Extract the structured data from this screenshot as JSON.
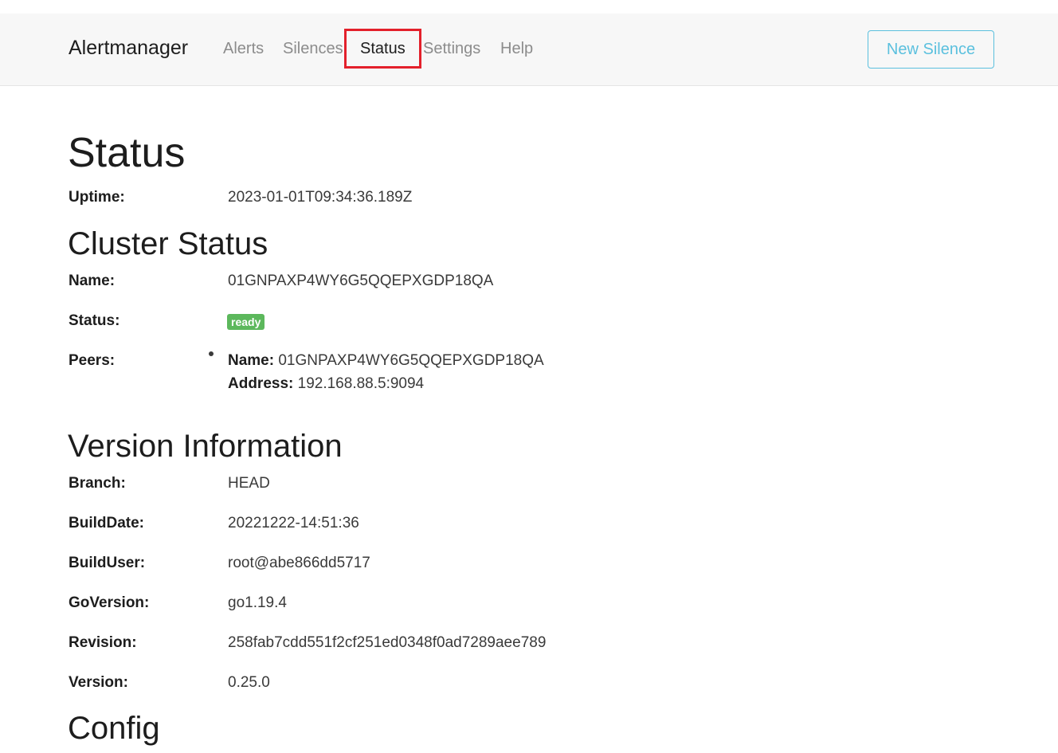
{
  "navbar": {
    "brand": "Alertmanager",
    "links": [
      "Alerts",
      "Silences",
      "Status",
      "Settings",
      "Help"
    ],
    "active": "Status",
    "new_silence_label": "New Silence"
  },
  "page_title": "Status",
  "uptime": {
    "label": "Uptime:",
    "value": "2023-01-01T09:34:36.189Z"
  },
  "cluster": {
    "heading": "Cluster Status",
    "name_label": "Name:",
    "name_value": "01GNPAXP4WY6G5QQEPXGDP18QA",
    "status_label": "Status:",
    "status_value": "ready",
    "peers_label": "Peers:",
    "peers": [
      {
        "name_key": "Name:",
        "name": "01GNPAXP4WY6G5QQEPXGDP18QA",
        "address_key": "Address:",
        "address": "192.168.88.5:9094"
      }
    ]
  },
  "version": {
    "heading": "Version Information",
    "rows": [
      {
        "label": "Branch:",
        "value": "HEAD"
      },
      {
        "label": "BuildDate:",
        "value": "20221222-14:51:36"
      },
      {
        "label": "BuildUser:",
        "value": "root@abe866dd5717"
      },
      {
        "label": "GoVersion:",
        "value": "go1.19.4"
      },
      {
        "label": "Revision:",
        "value": "258fab7cdd551f2cf251ed0348f0ad7289aee789"
      },
      {
        "label": "Version:",
        "value": "0.25.0"
      }
    ]
  },
  "config": {
    "heading": "Config"
  },
  "colors": {
    "accent_button": "#5bc0de",
    "status_badge": "#5cb85c",
    "highlight": "#e3202b"
  }
}
